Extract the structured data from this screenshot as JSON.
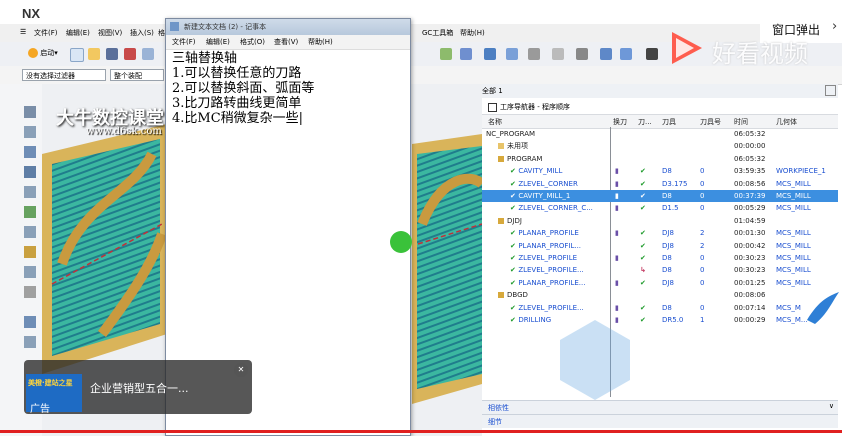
{
  "nx": {
    "logo": "NX",
    "menu": [
      "文件(F)",
      "编辑(E)",
      "视图(V)",
      "插入(S)",
      "格"
    ],
    "right_menu": [
      "GC工具箱",
      "帮助(H)"
    ],
    "start_label": "启动",
    "filter_select": "没有选择过滤器",
    "assembly_select": "整个装配"
  },
  "watermark": {
    "brand_cn": "大牛数控课堂",
    "brand_url": "www.d6sk.com"
  },
  "notepad": {
    "title": "新建文本文档 (2) - 记事本",
    "menu": [
      "文件(F)",
      "编辑(E)",
      "格式(O)",
      "查看(V)",
      "帮助(H)"
    ],
    "lines": [
      "三轴替换轴",
      "1.可以替换任意的刀路",
      "2.可以替换斜面、弧面等",
      "3.比刀路转曲线更简单",
      "4.比MC稍微复杂一些|"
    ]
  },
  "navigator": {
    "scope_label": "全部 1",
    "title": "工序导航器 - 程序顺序",
    "columns": [
      "名称",
      "换刀",
      "刀...",
      "刀具",
      "刀具号",
      "时间",
      "几何体"
    ],
    "rows": [
      {
        "indent": 0,
        "name": "NC_PROGRAM",
        "tool": "",
        "tool_no": "",
        "time": "06:05:32",
        "geom": "",
        "kind": "root",
        "toolchange": "",
        "check": ""
      },
      {
        "indent": 1,
        "name": "未用项",
        "tool": "",
        "tool_no": "",
        "time": "00:00:00",
        "geom": "",
        "kind": "folder",
        "toolchange": "",
        "check": ""
      },
      {
        "indent": 1,
        "name": "PROGRAM",
        "tool": "",
        "tool_no": "",
        "time": "06:05:32",
        "geom": "",
        "kind": "program",
        "toolchange": "",
        "check": ""
      },
      {
        "indent": 2,
        "name": "CAVITY_MILL",
        "tool": "D8",
        "tool_no": "0",
        "time": "03:59:35",
        "geom": "WORKPIECE_1",
        "kind": "op",
        "toolchange": "▮",
        "check": "✔"
      },
      {
        "indent": 2,
        "name": "ZLEVEL_CORNER",
        "tool": "D3.175",
        "tool_no": "0",
        "time": "00:08:56",
        "geom": "MCS_MILL",
        "kind": "op",
        "toolchange": "▮",
        "check": "✔"
      },
      {
        "indent": 2,
        "name": "CAVITY_MILL_1",
        "tool": "D8",
        "tool_no": "0",
        "time": "00:37:39",
        "geom": "MCS_MILL",
        "kind": "op",
        "toolchange": "▮",
        "check": "✔",
        "selected": true
      },
      {
        "indent": 2,
        "name": "ZLEVEL_CORNER_C...",
        "tool": "D1.5",
        "tool_no": "0",
        "time": "00:05:29",
        "geom": "MCS_MILL",
        "kind": "op",
        "toolchange": "▮",
        "check": "✔"
      },
      {
        "indent": 1,
        "name": "DJDJ",
        "tool": "",
        "tool_no": "",
        "time": "01:04:59",
        "geom": "",
        "kind": "program",
        "toolchange": "",
        "check": ""
      },
      {
        "indent": 2,
        "name": "PLANAR_PROFILE",
        "tool": "DJ8",
        "tool_no": "2",
        "time": "00:01:30",
        "geom": "MCS_MILL",
        "kind": "op",
        "toolchange": "▮",
        "check": "✔"
      },
      {
        "indent": 2,
        "name": "PLANAR_PROFIL...",
        "tool": "DJ8",
        "tool_no": "2",
        "time": "00:00:42",
        "geom": "MCS_MILL",
        "kind": "op",
        "toolchange": "",
        "check": "✔"
      },
      {
        "indent": 2,
        "name": "ZLEVEL_PROFILE",
        "tool": "D8",
        "tool_no": "0",
        "time": "00:30:23",
        "geom": "MCS_MILL",
        "kind": "op",
        "toolchange": "▮",
        "check": "✔"
      },
      {
        "indent": 2,
        "name": "ZLEVEL_PROFILE...",
        "tool": "D8",
        "tool_no": "0",
        "time": "00:30:23",
        "geom": "MCS_MILL",
        "kind": "op",
        "toolchange": "",
        "check": "↳"
      },
      {
        "indent": 2,
        "name": "PLANAR_PROFILE...",
        "tool": "DJ8",
        "tool_no": "0",
        "time": "00:01:25",
        "geom": "MCS_MILL",
        "kind": "op",
        "toolchange": "▮",
        "check": "✔"
      },
      {
        "indent": 1,
        "name": "DBGD",
        "tool": "",
        "tool_no": "",
        "time": "00:08:06",
        "geom": "",
        "kind": "program",
        "toolchange": "",
        "check": ""
      },
      {
        "indent": 2,
        "name": "ZLEVEL_PROFILE...",
        "tool": "D8",
        "tool_no": "0",
        "time": "00:07:14",
        "geom": "MCS_M",
        "kind": "op",
        "toolchange": "▮",
        "check": "✔"
      },
      {
        "indent": 2,
        "name": "DRILLING",
        "tool": "DR5.0",
        "tool_no": "1",
        "time": "00:00:29",
        "geom": "MCS_M...",
        "kind": "op",
        "toolchange": "▮",
        "check": "✔"
      }
    ],
    "panel_dependency": "相依性",
    "panel_details": "细节"
  },
  "overlay": {
    "popup_label": "窗口弹出",
    "popup_chevron": "›",
    "brand_logo_text": "好看视频",
    "ad_text": "企业营销型五合一...",
    "ad_tag": "广告",
    "ad_close": "✕",
    "ad_thumb_text": "美橙·建站之星"
  },
  "colors": {
    "selection": "#3c8fe0",
    "check": "#1d9a2a",
    "progress": "#e02020"
  }
}
